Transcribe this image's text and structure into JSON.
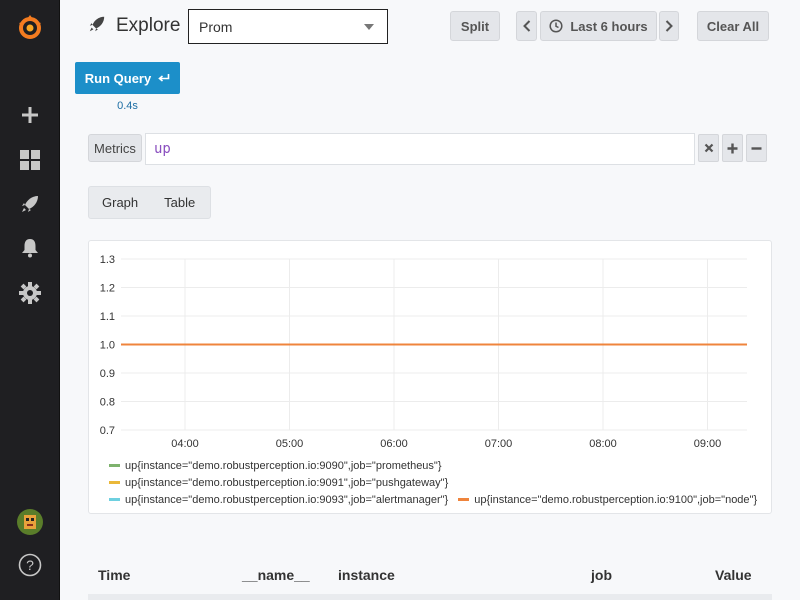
{
  "sidebar": {
    "items": [
      {
        "name": "grafana-logo-icon"
      },
      {
        "name": "plus-icon"
      },
      {
        "name": "dashboards-icon"
      },
      {
        "name": "explore-rocket-icon"
      },
      {
        "name": "alerting-bell-icon"
      },
      {
        "name": "configuration-gear-icon"
      },
      {
        "name": "user-avatar"
      },
      {
        "name": "help-icon",
        "label": "?"
      }
    ]
  },
  "header": {
    "title": "Explore",
    "datasource": "Prom",
    "split_label": "Split",
    "time_range": "Last 6 hours",
    "clear_label": "Clear All"
  },
  "query": {
    "run_label": "Run Query",
    "run_time": "0.4s",
    "metrics_label": "Metrics",
    "expression": "up"
  },
  "view_toggle": {
    "graph_label": "Graph",
    "table_label": "Table"
  },
  "chart_data": {
    "type": "line",
    "x": [
      "04:00",
      "05:00",
      "06:00",
      "07:00",
      "08:00",
      "09:00"
    ],
    "ylim": [
      0.7,
      1.3
    ],
    "yticks": [
      "1.3",
      "1.2",
      "1.1",
      "1.0",
      "0.9",
      "0.8",
      "0.7"
    ],
    "grid": true,
    "legend_position": "bottom",
    "series": [
      {
        "name": "up{instance=\"demo.robustperception.io:9090\",job=\"prometheus\"}",
        "color": "#7eb26d",
        "value": 1
      },
      {
        "name": "up{instance=\"demo.robustperception.io:9091\",job=\"pushgateway\"}",
        "color": "#eab839",
        "value": 1
      },
      {
        "name": "up{instance=\"demo.robustperception.io:9093\",job=\"alertmanager\"}",
        "color": "#6ed0e0",
        "value": 1
      },
      {
        "name": "up{instance=\"demo.robustperception.io:9100\",job=\"node\"}",
        "color": "#ef843c",
        "value": 1
      }
    ]
  },
  "table": {
    "columns": [
      "Time",
      "__name__",
      "instance",
      "job",
      "Value"
    ]
  }
}
